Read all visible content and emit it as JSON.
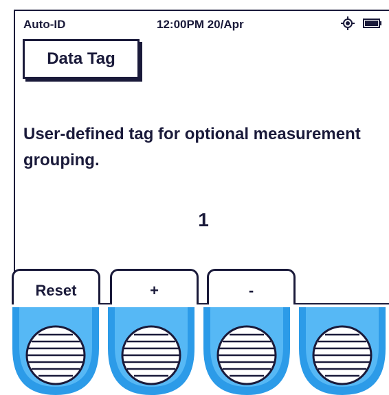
{
  "status_bar": {
    "mode": "Auto-ID",
    "datetime": "12:00PM 20/Apr",
    "gps_icon": "gps-locate-icon",
    "battery_icon": "battery-full-icon"
  },
  "title": "Data Tag",
  "description": "User-defined tag for optional measurement grouping.",
  "value": "1",
  "softkeys": [
    {
      "label": "Reset"
    },
    {
      "label": "+"
    },
    {
      "label": "-"
    }
  ],
  "hardware_buttons_count": 4,
  "colors": {
    "text": "#1a1a3a",
    "button_blue": "#2c9be8",
    "button_light": "#56b8f5"
  }
}
